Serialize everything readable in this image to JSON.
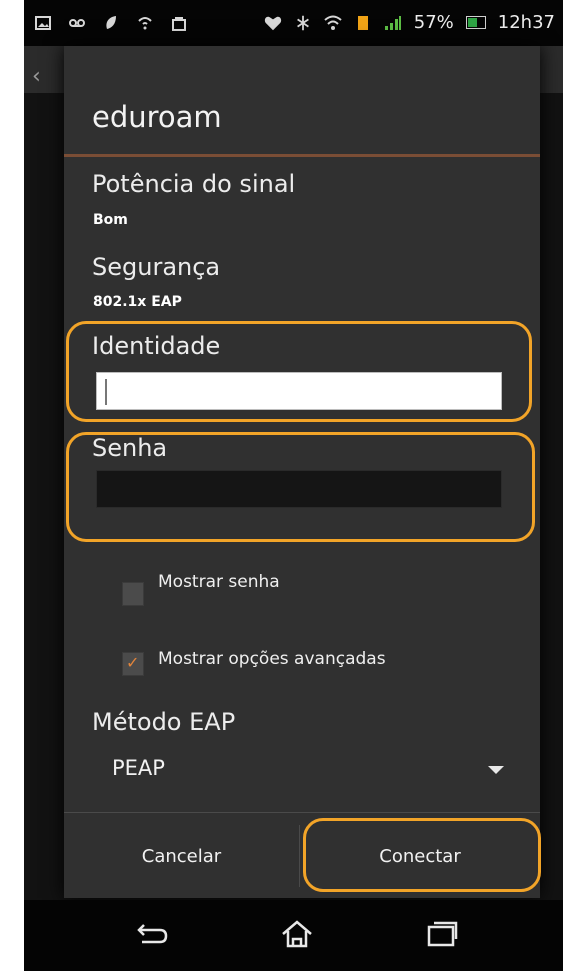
{
  "status_bar": {
    "battery_percent": "57%",
    "battery_level": 0.57,
    "time": "12h37",
    "icons": [
      "picture-icon",
      "voicemail-icon",
      "leaf-icon",
      "wifi-question-icon",
      "bag-icon",
      "heart-icon",
      "bluetooth-icon",
      "wifi-icon",
      "sim-icon",
      "signal-icon"
    ]
  },
  "dialog": {
    "title": "eduroam",
    "signal_label": "Potência do sinal",
    "signal_value": "Bom",
    "security_label": "Segurança",
    "security_value": "802.1x EAP",
    "identity_label": "Identidade",
    "identity_value": "",
    "password_label": "Senha",
    "password_value": "",
    "show_password_label": "Mostrar senha",
    "show_password_checked": false,
    "show_advanced_label": "Mostrar opções avançadas",
    "show_advanced_checked": true,
    "eap_method_label": "Método EAP",
    "eap_method_value": "PEAP",
    "cancel_label": "Cancelar",
    "connect_label": "Conectar"
  },
  "navigation": {
    "icons": [
      "back-icon",
      "home-icon",
      "recent-apps-icon"
    ]
  },
  "colors": {
    "accent": "#e1843b",
    "annotation": "#f2a428",
    "dialog_background": "#303030"
  }
}
